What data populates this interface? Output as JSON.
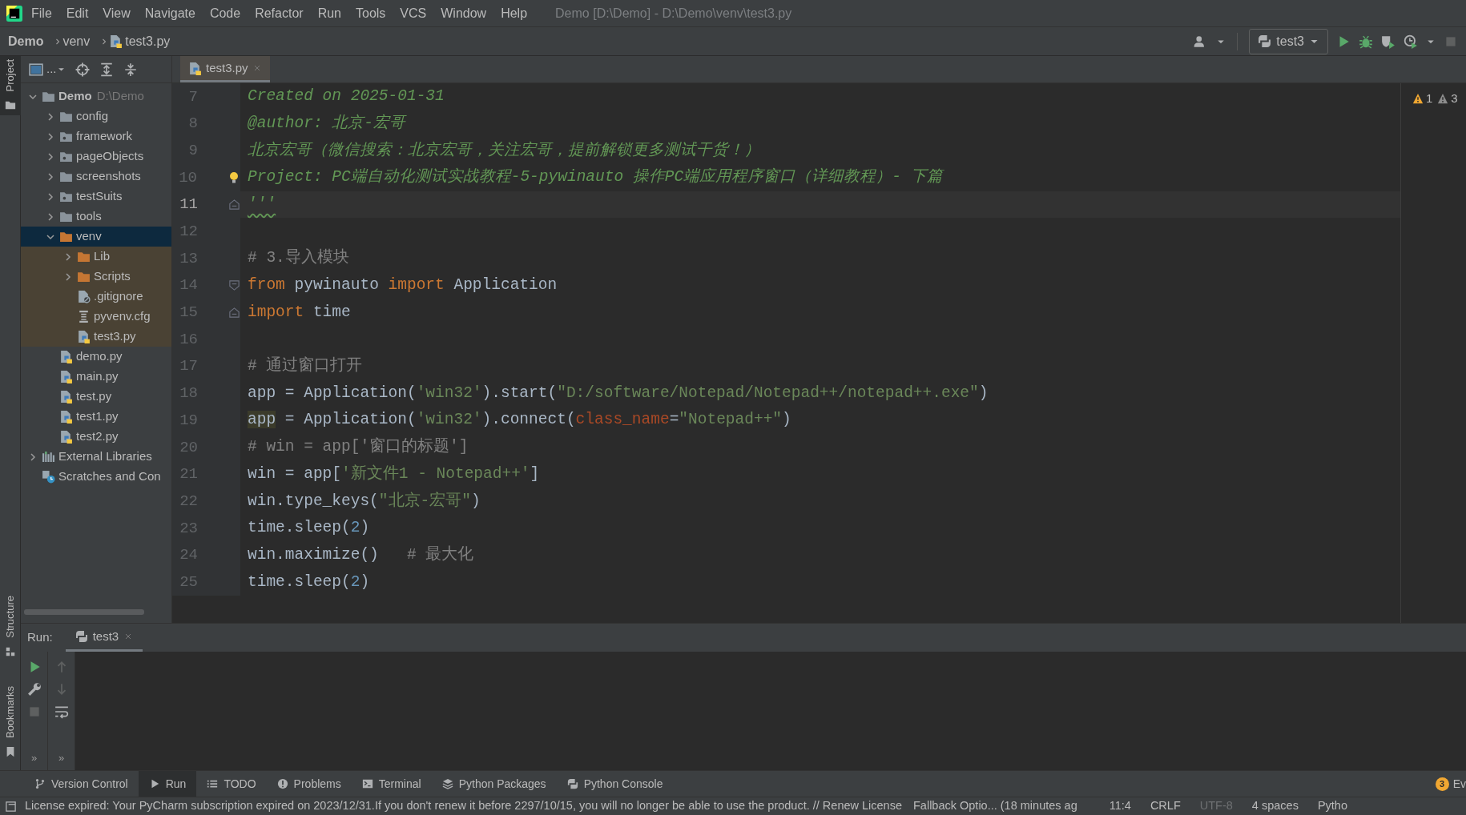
{
  "window": {
    "title": "Demo [D:\\Demo] - D:\\Demo\\venv\\test3.py"
  },
  "menu": [
    "File",
    "Edit",
    "View",
    "Navigate",
    "Code",
    "Refactor",
    "Run",
    "Tools",
    "VCS",
    "Window",
    "Help"
  ],
  "breadcrumb": [
    {
      "label": "Demo",
      "kind": "project"
    },
    {
      "label": "venv",
      "kind": "folder"
    },
    {
      "label": "test3.py",
      "kind": "python"
    }
  ],
  "run_config": {
    "label": "test3"
  },
  "project_toolbar": {
    "options_label": "..."
  },
  "toolbar_actions": [
    {
      "kind": "user",
      "disabled": false
    },
    {
      "kind": "run",
      "disabled": false
    },
    {
      "kind": "debug",
      "disabled": false
    },
    {
      "kind": "coverage",
      "disabled": false
    },
    {
      "kind": "profile",
      "disabled": false
    },
    {
      "kind": "stop",
      "disabled": true
    }
  ],
  "tool_strip": [
    {
      "label": "Project",
      "selected": true,
      "kind": "project"
    },
    {
      "label": "Structure",
      "selected": false,
      "kind": "structure"
    },
    {
      "label": "Bookmarks",
      "selected": false,
      "kind": "bookmarks"
    }
  ],
  "project_tree": [
    {
      "label": "Demo",
      "hint": "D:\\Demo",
      "kind": "folder",
      "expanded": true,
      "selected": false,
      "children": [
        {
          "label": "config",
          "kind": "folder",
          "expanded": false,
          "selected": false
        },
        {
          "label": "framework",
          "kind": "package",
          "expanded": false,
          "selected": false
        },
        {
          "label": "pageObjects",
          "kind": "package",
          "expanded": false,
          "selected": false
        },
        {
          "label": "screenshots",
          "kind": "folder",
          "expanded": false,
          "selected": false
        },
        {
          "label": "testSuits",
          "kind": "package",
          "expanded": false,
          "selected": false
        },
        {
          "label": "tools",
          "kind": "folder",
          "expanded": false,
          "selected": false
        },
        {
          "label": "venv",
          "kind": "excluded",
          "expanded": true,
          "selected": true,
          "children": [
            {
              "label": "Lib",
              "kind": "excluded",
              "expanded": false,
              "selected": false
            },
            {
              "label": "Scripts",
              "kind": "excluded",
              "expanded": false,
              "selected": false
            },
            {
              "label": ".gitignore",
              "kind": "git",
              "selected": false
            },
            {
              "label": "pyvenv.cfg",
              "kind": "cfg",
              "selected": false
            },
            {
              "label": "test3.py",
              "kind": "python",
              "selected": false
            }
          ]
        },
        {
          "label": "demo.py",
          "kind": "python",
          "selected": false
        },
        {
          "label": "main.py",
          "kind": "python",
          "selected": false
        },
        {
          "label": "test.py",
          "kind": "python",
          "selected": false
        },
        {
          "label": "test1.py",
          "kind": "python",
          "selected": false
        },
        {
          "label": "test2.py",
          "kind": "python",
          "selected": false
        }
      ]
    },
    {
      "label": "External Libraries",
      "kind": "libraries",
      "expanded": false,
      "selected": false
    },
    {
      "label": "Scratches and Con",
      "kind": "scratches",
      "selected": false
    }
  ],
  "editor_tabs": [
    {
      "label": "test3.py",
      "selected": true
    }
  ],
  "code_lines": [
    {
      "number": "7",
      "current": false,
      "fold_start": false,
      "fold_end": false,
      "tokens": [
        {
          "text": "Created on 2025-01-31",
          "kind": "doc"
        }
      ]
    },
    {
      "number": "8",
      "current": false,
      "fold_start": false,
      "fold_end": false,
      "tokens": [
        {
          "text": "@author: 北京-宏哥",
          "kind": "doc"
        }
      ]
    },
    {
      "number": "9",
      "current": false,
      "fold_start": false,
      "fold_end": false,
      "tokens": [
        {
          "text": "北京宏哥（微信搜索：北京宏哥，关注宏哥，提前解锁更多测试干货！）",
          "kind": "doc"
        }
      ]
    },
    {
      "number": "10",
      "current": false,
      "fold_start": false,
      "fold_end": false,
      "bulb": true,
      "tokens": [
        {
          "text": "Project: PC端自动化测试实战教程-5-pywinauto 操作PC端应用程序窗口（详细教程）- 下篇",
          "kind": "doc"
        }
      ]
    },
    {
      "number": "11",
      "current": true,
      "fold_start": false,
      "fold_end": true,
      "tokens": [
        {
          "text": "'''",
          "kind": "doc",
          "typo": true
        }
      ]
    },
    {
      "number": "12",
      "current": false,
      "fold_start": false,
      "fold_end": false
    },
    {
      "number": "13",
      "current": false,
      "fold_start": false,
      "fold_end": false,
      "tokens": [
        {
          "text": "# 3.导入模块",
          "kind": "comment"
        }
      ]
    },
    {
      "number": "14",
      "current": false,
      "fold_start": true,
      "fold_end": false,
      "tokens": [
        {
          "text": "from",
          "kind": "keyword"
        },
        {
          "text": " pywinauto ",
          "kind": "plain"
        },
        {
          "text": "import",
          "kind": "keyword"
        },
        {
          "text": " Application",
          "kind": "plain"
        }
      ]
    },
    {
      "number": "15",
      "current": false,
      "fold_start": false,
      "fold_end": true,
      "tokens": [
        {
          "text": "import",
          "kind": "keyword"
        },
        {
          "text": " time",
          "kind": "plain"
        }
      ]
    },
    {
      "number": "16",
      "current": false,
      "fold_start": false,
      "fold_end": false
    },
    {
      "number": "17",
      "current": false,
      "fold_start": false,
      "fold_end": false,
      "tokens": [
        {
          "text": "# 通过窗口打开",
          "kind": "comment"
        }
      ]
    },
    {
      "number": "18",
      "current": false,
      "fold_start": false,
      "fold_end": false,
      "tokens": [
        {
          "text": "app = Application(",
          "kind": "plain"
        },
        {
          "text": "'win32'",
          "kind": "string"
        },
        {
          "text": ").start(",
          "kind": "plain"
        },
        {
          "text": "\"D:/software/Notepad/Notepad++/notepad++.exe\"",
          "kind": "string"
        },
        {
          "text": ")",
          "kind": "plain"
        }
      ]
    },
    {
      "number": "19",
      "current": false,
      "fold_start": false,
      "fold_end": false,
      "tokens": [
        {
          "text": "app",
          "kind": "highlight"
        },
        {
          "text": " = Application(",
          "kind": "plain"
        },
        {
          "text": "'win32'",
          "kind": "string"
        },
        {
          "text": ").connect(",
          "kind": "plain"
        },
        {
          "text": "class_name",
          "kind": "param"
        },
        {
          "text": "=",
          "kind": "plain"
        },
        {
          "text": "\"Notepad++\"",
          "kind": "string"
        },
        {
          "text": ")",
          "kind": "plain"
        }
      ]
    },
    {
      "number": "20",
      "current": false,
      "fold_start": false,
      "fold_end": false,
      "tokens": [
        {
          "text": "# win = app['窗口的标题']",
          "kind": "comment"
        }
      ]
    },
    {
      "number": "21",
      "current": false,
      "fold_start": false,
      "fold_end": false,
      "tokens": [
        {
          "text": "win = app[",
          "kind": "plain"
        },
        {
          "text": "'新文件1 - Notepad++'",
          "kind": "string"
        },
        {
          "text": "]",
          "kind": "plain"
        }
      ]
    },
    {
      "number": "22",
      "current": false,
      "fold_start": false,
      "fold_end": false,
      "tokens": [
        {
          "text": "win.type_keys(",
          "kind": "plain"
        },
        {
          "text": "\"北京-宏哥\"",
          "kind": "string"
        },
        {
          "text": ")",
          "kind": "plain"
        }
      ]
    },
    {
      "number": "23",
      "current": false,
      "fold_start": false,
      "fold_end": false,
      "tokens": [
        {
          "text": "time.sleep(",
          "kind": "plain"
        },
        {
          "text": "2",
          "kind": "number"
        },
        {
          "text": ")",
          "kind": "plain"
        }
      ]
    },
    {
      "number": "24",
      "current": false,
      "fold_start": false,
      "fold_end": false,
      "tokens": [
        {
          "text": "win.maximize()   ",
          "kind": "plain"
        },
        {
          "text": "# 最大化",
          "kind": "comment"
        }
      ]
    },
    {
      "number": "25",
      "current": false,
      "fold_start": false,
      "fold_end": false,
      "tokens": [
        {
          "text": "time.sleep(",
          "kind": "plain"
        },
        {
          "text": "2",
          "kind": "number"
        },
        {
          "text": ")",
          "kind": "plain"
        }
      ]
    }
  ],
  "inspections": [
    {
      "count": "1",
      "kind": "warning"
    },
    {
      "count": "3",
      "kind": "weak"
    }
  ],
  "run_panel": {
    "label": "Run:",
    "tabs": [
      {
        "label": "test3",
        "selected": true
      }
    ],
    "toolbars": [
      {
        "actions": [
          {
            "kind": "run",
            "disabled": false
          },
          {
            "kind": "wrench",
            "disabled": false
          },
          {
            "kind": "stop",
            "disabled": true
          }
        ],
        "more": "»"
      },
      {
        "actions": [
          {
            "kind": "up",
            "disabled": true
          },
          {
            "kind": "down",
            "disabled": true
          },
          {
            "kind": "wrap",
            "disabled": false
          }
        ],
        "more": "»"
      }
    ]
  },
  "tool_windows": [
    {
      "label": "Version Control",
      "kind": "vcs",
      "selected": false
    },
    {
      "label": "Run",
      "kind": "run",
      "selected": true
    },
    {
      "label": "TODO",
      "kind": "todo",
      "selected": false
    },
    {
      "label": "Problems",
      "kind": "problems",
      "selected": false
    },
    {
      "label": "Terminal",
      "kind": "terminal",
      "selected": false
    },
    {
      "label": "Python Packages",
      "kind": "packages",
      "selected": false
    },
    {
      "label": "Python Console",
      "kind": "console",
      "selected": false
    }
  ],
  "event_log": {
    "count": "3",
    "label": "Ev"
  },
  "status_bar": {
    "message": "License expired: Your PyCharm subscription expired on 2023/12/31.If you don't renew it before 2297/10/15, you will no longer be able to use the product. // Renew License",
    "secondary": "Fallback Optio... (18 minutes ag",
    "items": [
      {
        "text": "11:4",
        "disabled": false
      },
      {
        "text": "CRLF",
        "disabled": false
      },
      {
        "text": "UTF-8",
        "disabled": true
      },
      {
        "text": "4 spaces",
        "disabled": false
      },
      {
        "text": "Pytho",
        "disabled": false
      }
    ]
  }
}
